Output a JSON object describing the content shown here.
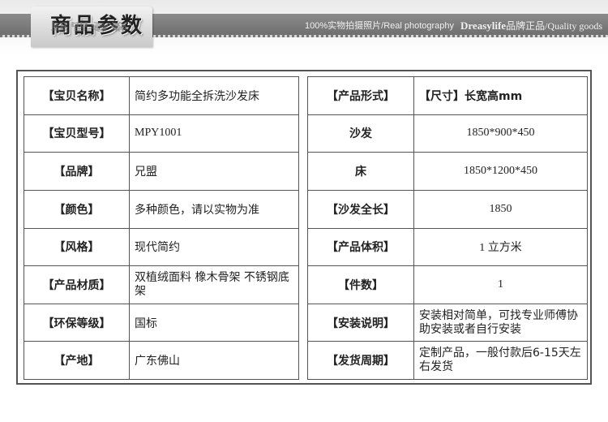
{
  "banner": {
    "title": "商品参数",
    "reflection": "商品参数",
    "tagline_left": "100%实物拍摄照片/Real photography",
    "brand": "Dreasylife",
    "tagline_right": "品牌正品/Quality goods"
  },
  "left_rows": [
    {
      "label": "【宝贝名称】",
      "value": "简约多功能全拆洗沙发床"
    },
    {
      "label": "【宝贝型号】",
      "value": "MPY1001"
    },
    {
      "label": "【品牌】",
      "value": "兄盟"
    },
    {
      "label": "【颜色】",
      "value": "多种颜色，请以实物为准"
    },
    {
      "label": "【风格】",
      "value": "现代简约"
    },
    {
      "label": "【产品材质】",
      "value": "双植绒面料 橡木骨架 不锈钢底架"
    },
    {
      "label": "【环保等级】",
      "value": "国标"
    },
    {
      "label": "【产地】",
      "value": "广东佛山"
    }
  ],
  "right_rows": [
    {
      "label": "【产品形式】",
      "value": "【尺寸】长宽高mm"
    },
    {
      "label": "沙发",
      "value": "1850*900*450"
    },
    {
      "label": "床",
      "value": "1850*1200*450"
    },
    {
      "label": "【沙发全长】",
      "value": "1850"
    },
    {
      "label": "【产品体积】",
      "value": "1 立方米"
    },
    {
      "label": "【件数】",
      "value": "1"
    },
    {
      "label": "【安装说明】",
      "value": "安装相对简单，可找专业师傅协助安装或者自行安装"
    },
    {
      "label": "【发货周期】",
      "value": "定制产品，一般付款后6-15天左右发货"
    }
  ]
}
